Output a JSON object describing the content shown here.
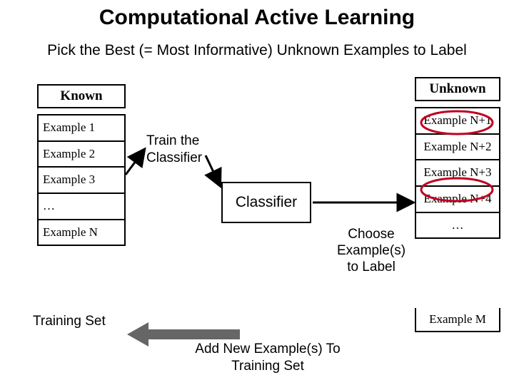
{
  "title": "Computational Active Learning",
  "subtitle": "Pick the Best (= Most Informative) Unknown Examples to Label",
  "known_header": "Known",
  "unknown_header": "Unknown",
  "known_items": [
    "Example 1",
    "Example 2",
    "Example 3",
    "…",
    "Example N"
  ],
  "unknown_items": [
    "Example N+1",
    "Example N+2",
    "Example N+3",
    "Example N+4",
    "…"
  ],
  "unknown_last": "Example M",
  "training_set_label": "Training Set",
  "train_label": "Train the\nClassifier",
  "classifier_label": "Classifier",
  "choose_label": "Choose Example(s) to Label",
  "add_label": "Add New Example(s) To Training Set",
  "highlight_color": "#c00020"
}
